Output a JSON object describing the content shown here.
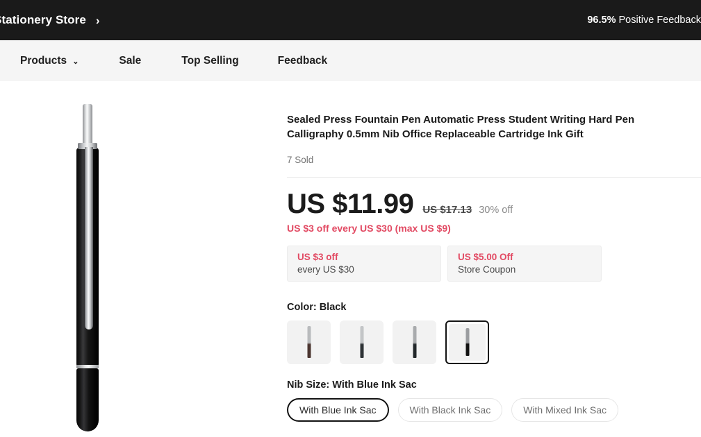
{
  "header": {
    "store_name": "Stationery Store",
    "chevron": "›",
    "feedback_percent": "96.5%",
    "feedback_label": " Positive Feedback",
    "background_color": "#1a1a1a"
  },
  "nav": {
    "items": [
      {
        "label": "Products",
        "has_caret": true,
        "caret": "⌄"
      },
      {
        "label": "Sale",
        "has_caret": false
      },
      {
        "label": "Top Selling",
        "has_caret": false
      },
      {
        "label": "Feedback",
        "has_caret": false
      }
    ]
  },
  "product": {
    "title": "Sealed Press Fountain Pen Automatic Press Student Writing Hard Pen Calligraphy 0.5mm Nib Office Replaceable Cartridge Ink Gift",
    "sold": "7 Sold"
  },
  "price": {
    "current": "US $11.99",
    "original": "US $17.13",
    "discount": "30% off",
    "promo": "US $3 off every US $30 (max US $9)",
    "accent_color": "#e24a63"
  },
  "coupons": [
    {
      "title": "US $3 off",
      "subtitle": "every US $30"
    },
    {
      "title": "US $5.00 Off",
      "subtitle": "Store Coupon"
    }
  ],
  "color_option": {
    "label": "Color: Black",
    "selected_index": 3,
    "swatches": [
      {
        "name": "swatch-1",
        "top_color": "#b9bbbd",
        "bottom_color": "#4b3530"
      },
      {
        "name": "swatch-2",
        "top_color": "#c3c5c7",
        "bottom_color": "#2e3336"
      },
      {
        "name": "swatch-3",
        "top_color": "#a9abad",
        "bottom_color": "#23282b"
      },
      {
        "name": "swatch-4",
        "top_color": "#9b9da0",
        "bottom_color": "#121212"
      }
    ]
  },
  "nib_option": {
    "label": "Nib Size: With Blue Ink Sac",
    "selected_index": 0,
    "choices": [
      {
        "label": "With Blue Ink Sac"
      },
      {
        "label": "With Black Ink Sac"
      },
      {
        "label": "With Mixed Ink Sac"
      }
    ]
  }
}
